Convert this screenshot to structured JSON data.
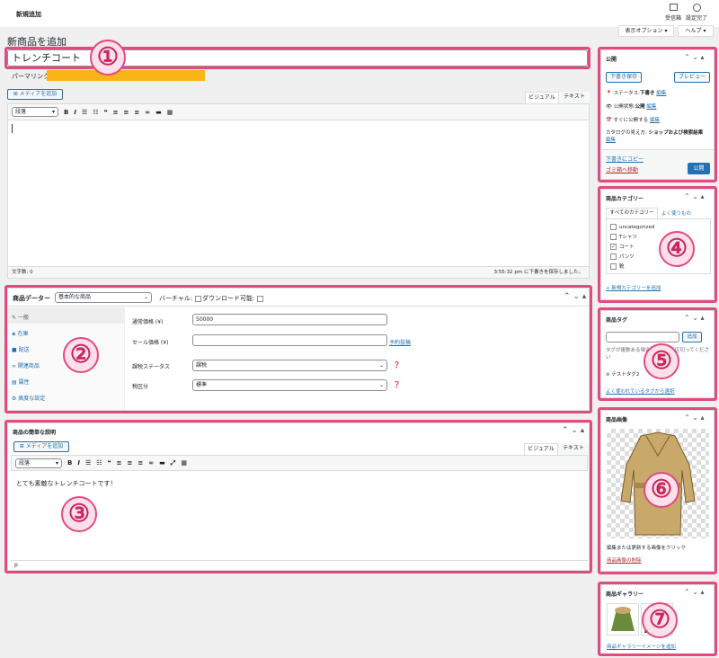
{
  "topbar": {
    "title": "新規追加",
    "inbox_label": "受信箱",
    "setup_label": "設定完了"
  },
  "screen_options": {
    "label": "表示オプション ▾"
  },
  "help": {
    "label": "ヘルプ ▾"
  },
  "page_title": "新商品を追加",
  "product_title": "トレンチコート",
  "permalink_label": "パーマリンク:",
  "editor": {
    "media_button": "メディアを追加",
    "visual_tab": "ビジュアル",
    "text_tab": "テキスト",
    "format_select": "段落",
    "word_count": "文字数: 0",
    "saved_status": "3:55:32 pm に下書きを保存しました。"
  },
  "product_data": {
    "title": "商品データー",
    "type_select": "基本的な商品",
    "virtual_label": "バーチャル:",
    "download_label": "ダウンロード可能:",
    "tabs": [
      {
        "label": "一般",
        "icon": "wrench-icon"
      },
      {
        "label": "在庫",
        "icon": "tag-icon"
      },
      {
        "label": "配送",
        "icon": "truck-icon"
      },
      {
        "label": "関連商品",
        "icon": "link-icon"
      },
      {
        "label": "属性",
        "icon": "list-icon"
      },
      {
        "label": "高度な設定",
        "icon": "gear-icon"
      }
    ],
    "regular_price_label": "通常価格 (¥)",
    "regular_price_value": "50000",
    "sale_price_label": "セール価格 (¥)",
    "schedule_link": "予約投稿",
    "tax_status_label": "課税ステータス",
    "tax_status_value": "課税",
    "tax_class_label": "税区分",
    "tax_class_value": "標準"
  },
  "short_desc": {
    "title": "商品の簡単な説明",
    "media_button": "メディアを追加",
    "visual_tab": "ビジュアル",
    "text_tab": "テキスト",
    "format_select": "段落",
    "content": "とても素敵なトレンチコートです！",
    "path": "p"
  },
  "publish": {
    "title": "公開",
    "save_draft": "下書き保存",
    "preview": "プレビュー",
    "status_label": "ステータス:",
    "status_value": "下書き",
    "edit": "編集",
    "visibility_label": "公開状態:",
    "visibility_value": "公開",
    "publish_now": "すぐに公開する",
    "catalog_label": "カタログの見え方:",
    "catalog_value": "ショップおよび検索結果",
    "copy_link": "下書きにコピー",
    "trash_link": "ゴミ箱へ移動",
    "publish_button": "公開"
  },
  "categories": {
    "title": "商品カテゴリー",
    "tab_all": "すべてのカテゴリー",
    "tab_popular": "よく使うもの",
    "items": [
      {
        "label": "uncategorized",
        "checked": false
      },
      {
        "label": "Tシャツ",
        "checked": false
      },
      {
        "label": "コート",
        "checked": true
      },
      {
        "label": "パンツ",
        "checked": false
      },
      {
        "label": "靴",
        "checked": false
      }
    ],
    "add_link": "+ 新規カテゴリーを追加"
  },
  "tags": {
    "title": "商品タグ",
    "add_button": "追加",
    "hint": "タグが複数ある場合はコンマで区切ってください",
    "tag": "テストタグ2",
    "popular_link": "よく使われているタグから選択"
  },
  "product_image": {
    "title": "商品画像",
    "hint": "編集または更新する画像をクリック",
    "remove_link": "商品画像の削除"
  },
  "gallery": {
    "title": "商品ギャラリー",
    "add_link": "商品ギャラリーイメージを追加"
  },
  "badges": [
    "①",
    "②",
    "③",
    "④",
    "⑤",
    "⑥",
    "⑦"
  ],
  "colors": {
    "highlight": "#e34a7f",
    "accent": "#2271b1",
    "permalink_bar": "#f9b518"
  }
}
